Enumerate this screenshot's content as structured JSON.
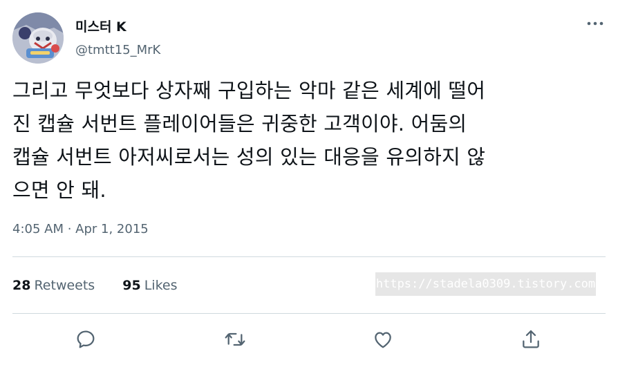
{
  "author": {
    "display_name": "미스터 K",
    "handle": "@tmtt15_MrK"
  },
  "tweet": {
    "lines": [
      "그리고 무엇보다 상자째 구입하는 악마 같은 세계에 떨어",
      "진 캡슐 서번트 플레이어들은 귀중한 고객이야. 어둠의",
      "캡슐 서번트 아저씨로서는 성의 있는 대응을 유의하지 않",
      "으면 안 돼."
    ],
    "timestamp": "4:05 AM · Apr 1, 2015"
  },
  "stats": {
    "retweets_count": "28",
    "retweets_label": "Retweets",
    "likes_count": "95",
    "likes_label": "Likes"
  },
  "watermark": "https://stadela0309.tistory.com",
  "icons": {
    "more": "more-icon",
    "reply": "reply-icon",
    "retweet": "retweet-icon",
    "like": "like-icon",
    "share": "share-icon"
  },
  "colors": {
    "text_primary": "#0f1419",
    "text_secondary": "#536471",
    "divider": "#cfd9de"
  }
}
